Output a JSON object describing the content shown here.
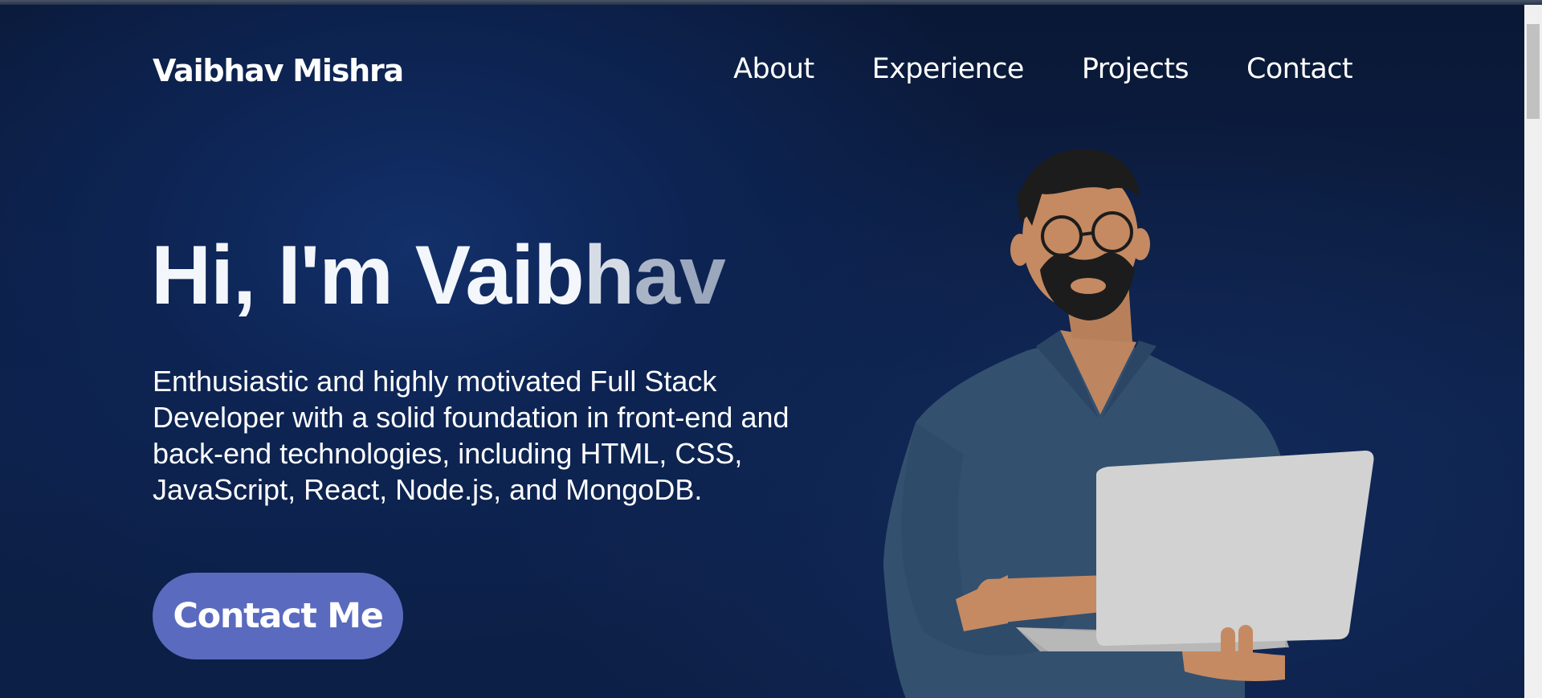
{
  "header": {
    "brand": "Vaibhav Mishra",
    "nav": [
      "About",
      "Experience",
      "Projects",
      "Contact"
    ]
  },
  "hero": {
    "greeting_solid": "Hi, I'm Vaib",
    "greeting_fade_1": "h",
    "greeting_fade_2": "a",
    "greeting_fade_3": "v",
    "description": "Enthusiastic and highly motivated Full Stack Developer with a solid foundation in front-end and back-end technologies, including HTML, CSS, JavaScript, React, Node.js, and MongoDB.",
    "cta_label": "Contact Me"
  },
  "illustration": {
    "icon": "developer-with-laptop-illustration",
    "colors": {
      "shirt": "#33506f",
      "skin": "#c58a62",
      "hair": "#1c1c1c",
      "laptop": "#d2d2d2"
    }
  },
  "colors": {
    "background": "#0d2453",
    "button": "#5a6bbf",
    "text": "#ffffff"
  }
}
